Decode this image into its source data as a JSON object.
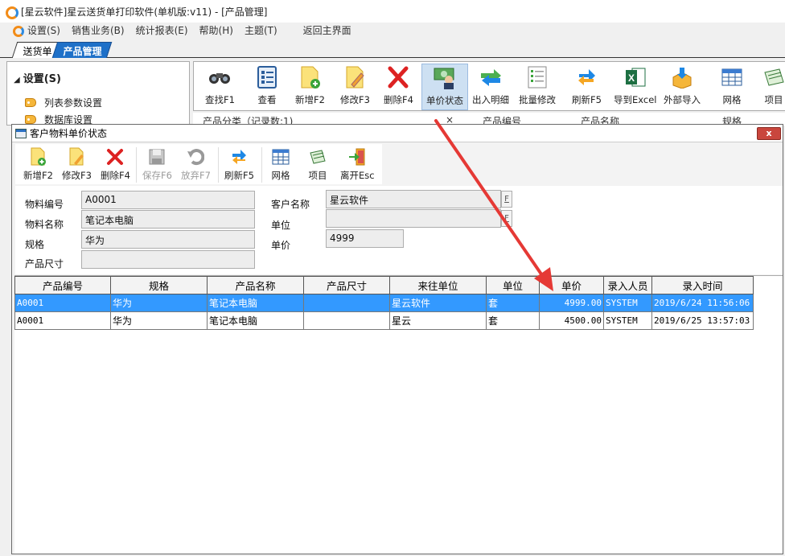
{
  "app": {
    "title": "[星云软件]星云送货单打印软件(单机版:v11) - [产品管理]"
  },
  "menubar": {
    "items": [
      "设置(S)",
      "销售业务(B)",
      "统计报表(E)",
      "帮助(H)",
      "主题(T)"
    ],
    "home": "返回主界面"
  },
  "doc_tabs": {
    "inactive": "送货单",
    "active": "产品管理"
  },
  "left_panel": {
    "group": "设置(S)",
    "items": [
      "列表参数设置",
      "数据库设置"
    ]
  },
  "main_toolbar": {
    "buttons": [
      "查找F1",
      "查看",
      "新增F2",
      "修改F3",
      "删除F4",
      "单价状态",
      "出入明细",
      "批量修改",
      "刷新F5",
      "导到Excel",
      "外部导入",
      "网格",
      "项目"
    ],
    "selected": "单价状态"
  },
  "behind_header": {
    "category": "产品分类（记录数:1)",
    "close": "×",
    "col1": "产品编号",
    "col2": "产品名称",
    "col3": "规格"
  },
  "dialog": {
    "title": "客户物料单价状态",
    "close": "x",
    "toolbar": {
      "add": "新增F2",
      "edit": "修改F3",
      "delete": "删除F4",
      "save": "保存F6",
      "discard": "放弃F7",
      "refresh": "刷新F5",
      "grid": "网格",
      "items": "项目",
      "exit": "离开Esc"
    },
    "form": {
      "code_label": "物料编号",
      "code_value": "A0001",
      "name_label": "物料名称",
      "name_value": "笔记本电脑",
      "spec_label": "规格",
      "spec_value": "华为",
      "size_label": "产品尺寸",
      "size_value": "",
      "customer_label": "客户名称",
      "customer_value": "星云软件",
      "unit_label": "单位",
      "unit_value": "",
      "price_label": "单价",
      "price_value": "4999",
      "picker": "F"
    },
    "grid": {
      "columns": [
        "产品编号",
        "规格",
        "产品名称",
        "产品尺寸",
        "来往单位",
        "单位",
        "单价",
        "录入人员",
        "录入时间"
      ],
      "rows": [
        {
          "code": "A0001",
          "spec": "华为",
          "name": "笔记本电脑",
          "size": "",
          "partner": "星云软件",
          "unit": "套",
          "price": "4999.00",
          "user": "SYSTEM",
          "time": "2019/6/24 11:56:06"
        },
        {
          "code": "A0001",
          "spec": "华为",
          "name": "笔记本电脑",
          "size": "",
          "partner": "星云",
          "unit": "套",
          "price": "4500.00",
          "user": "SYSTEM",
          "time": "2019/6/25 13:57:03"
        }
      ],
      "selected_row": 0
    }
  },
  "colors": {
    "selection": "#3399ff",
    "active_tab": "#1e70c8",
    "annotation_arrow": "#e53935",
    "close_button": "#c9463d"
  }
}
